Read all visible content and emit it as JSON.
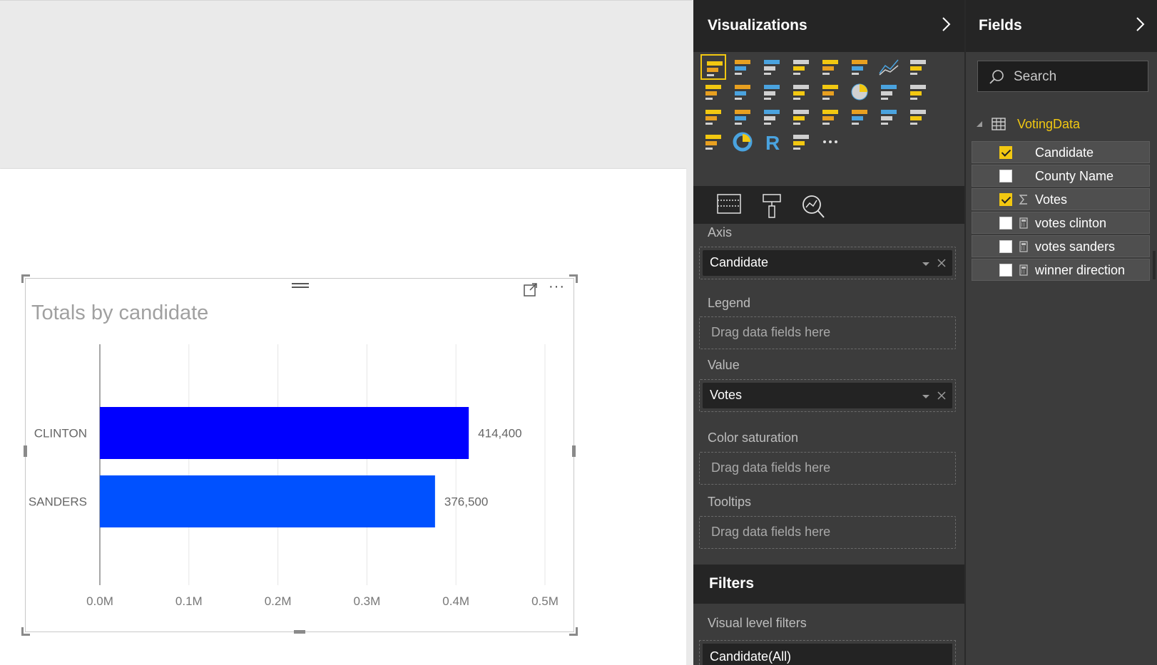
{
  "chart": {
    "title": "Totals by candidate"
  },
  "chart_data": {
    "type": "bar",
    "orientation": "horizontal",
    "title": "Totals by candidate",
    "categories": [
      "CLINTON",
      "SANDERS"
    ],
    "values": [
      414400,
      376500
    ],
    "data_labels": [
      "414,400",
      "376,500"
    ],
    "colors": [
      "#0000ff",
      "#0051ff"
    ],
    "xlim": [
      0,
      500000
    ],
    "x_ticks": [
      "0.0M",
      "0.1M",
      "0.2M",
      "0.3M",
      "0.4M",
      "0.5M"
    ],
    "grid": true,
    "xlabel": "",
    "ylabel": ""
  },
  "visualizations": {
    "title": "Visualizations",
    "gallery_icons": [
      "stacked-bar-chart-icon",
      "stacked-column-chart-icon",
      "clustered-bar-chart-icon",
      "clustered-column-chart-icon",
      "100-stacked-bar-chart-icon",
      "100-stacked-column-chart-icon",
      "line-chart-icon",
      "area-chart-icon",
      "stacked-area-chart-icon",
      "line-and-stacked-column-chart-icon",
      "line-and-clustered-column-chart-icon",
      "ribbon-chart-icon",
      "scatter-chart-icon",
      "pie-chart-icon",
      "treemap-icon",
      "map-icon",
      "table-icon",
      "matrix-icon",
      "filled-map-icon",
      "funnel-icon",
      "gauge-icon",
      "multi-row-card-icon",
      "card-icon",
      "kpi-icon",
      "slicer-icon",
      "donut-chart-icon",
      "r-script-visual-icon",
      "shape-map-icon",
      "more-visuals-icon"
    ],
    "tabs": [
      "fields-tab-icon",
      "format-tab-icon",
      "analytics-tab-icon"
    ],
    "wells": {
      "axis": {
        "label": "Axis",
        "value": "Candidate"
      },
      "legend": {
        "label": "Legend",
        "placeholder": "Drag data fields here"
      },
      "value": {
        "label": "Value",
        "value": "Votes"
      },
      "color_saturation": {
        "label": "Color saturation",
        "placeholder": "Drag data fields here"
      },
      "tooltips": {
        "label": "Tooltips",
        "placeholder": "Drag data fields here"
      }
    },
    "filters": {
      "title": "Filters",
      "visual_level_label": "Visual level filters",
      "filter_pill": "Candidate(All)"
    },
    "more_glyph": "···"
  },
  "fields": {
    "title": "Fields",
    "search_placeholder": "Search",
    "table_name": "VotingData",
    "items": [
      {
        "name": "Candidate",
        "checked": true,
        "icon": ""
      },
      {
        "name": "County Name",
        "checked": false,
        "icon": ""
      },
      {
        "name": "Votes",
        "checked": true,
        "icon": "sigma-icon"
      },
      {
        "name": "votes clinton",
        "checked": false,
        "icon": "calculator-icon"
      },
      {
        "name": "votes sanders",
        "checked": false,
        "icon": "calculator-icon"
      },
      {
        "name": "winner direction",
        "checked": false,
        "icon": "calculator-icon"
      }
    ]
  },
  "colors": {
    "accent": "#f2c811",
    "pane_dark": "#252525",
    "pane_mid": "#3c3c3c",
    "bar_clinton": "#0000ff",
    "bar_sanders": "#0051ff"
  }
}
